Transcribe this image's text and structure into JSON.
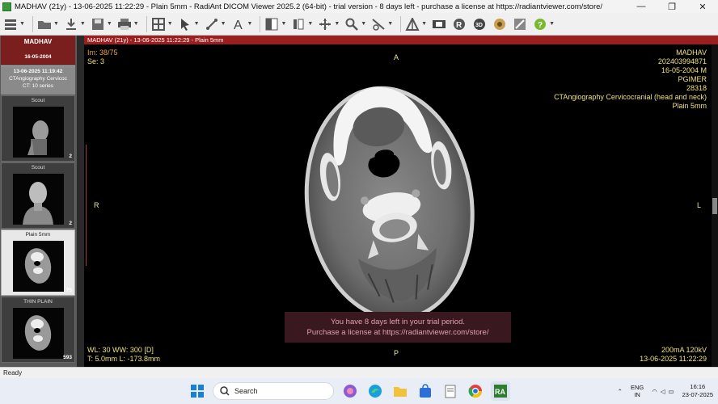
{
  "window": {
    "title": "MADHAV (21y) - 13-06-2025 11:22:29 - Plain 5mm - RadiAnt DICOM Viewer 2025.2 (64-bit) - trial version - 8 days left - purchase a license at https://radiantviewer.com/store/",
    "minimize": "—",
    "maximize": "❐",
    "close": "✕"
  },
  "toolbar": {
    "buttons": [
      "menu-icon",
      "open-folder-icon",
      "download-icon",
      "save-icon",
      "print-icon",
      "layout-icon",
      "cursor-icon",
      "measure-icon",
      "text-annotation-icon",
      "window-level-icon",
      "invert-icon",
      "pan-icon",
      "zoom-icon",
      "scroll-icon",
      "mpr-icon",
      "film-icon",
      "reset-icon",
      "3d-icon",
      "fusion-icon",
      "ruler-icon",
      "help-icon"
    ]
  },
  "patient": {
    "name": "MADHAV",
    "dob": "16-05-2004"
  },
  "study": {
    "datetime": "13-06-2025 11:19:42",
    "description": "CTAngiography Cervicoc",
    "modality_series": "CT: 10 series"
  },
  "series": [
    {
      "label": "Scout",
      "count": "2"
    },
    {
      "label": "Scout",
      "count": "2"
    },
    {
      "label": "Plain 5mm",
      "count": "75"
    },
    {
      "label": "THIN PLAIN",
      "count": "593"
    }
  ],
  "viewer": {
    "header": "MADHAV  (21y) - 13-06-2025 11:22:29 - Plain 5mm",
    "top_left": [
      "Im: 38/75",
      "Se: 3"
    ],
    "top_right": [
      "MADHAV",
      "202403994871",
      "16-05-2004 M",
      "PGIMER",
      "28318",
      "CTAngiography Cervicocranial (head and neck)",
      "Plain 5mm"
    ],
    "bottom_left": [
      "WL: 30 WW: 300 [D]",
      "T: 5.0mm L: -173.8mm"
    ],
    "bottom_right": [
      "200mA 120kV",
      "13-06-2025 11:22:29"
    ],
    "orient_top": "A",
    "orient_bottom": "P",
    "orient_left": "R",
    "orient_right": "L",
    "trial_line1": "You have 8 days left in your trial period.",
    "trial_line2": "Purchase a license at https://radiantviewer.com/store/"
  },
  "status": {
    "text": "Ready"
  },
  "taskbar": {
    "search": "Search",
    "lang1": "ENG",
    "lang2": "IN",
    "time": "16:16",
    "date": "23-07-2025"
  },
  "colors": {
    "header_red": "#9b1f1f",
    "overlay_yellow": "#f0e07a",
    "overlay_orange": "#e8a24a"
  }
}
